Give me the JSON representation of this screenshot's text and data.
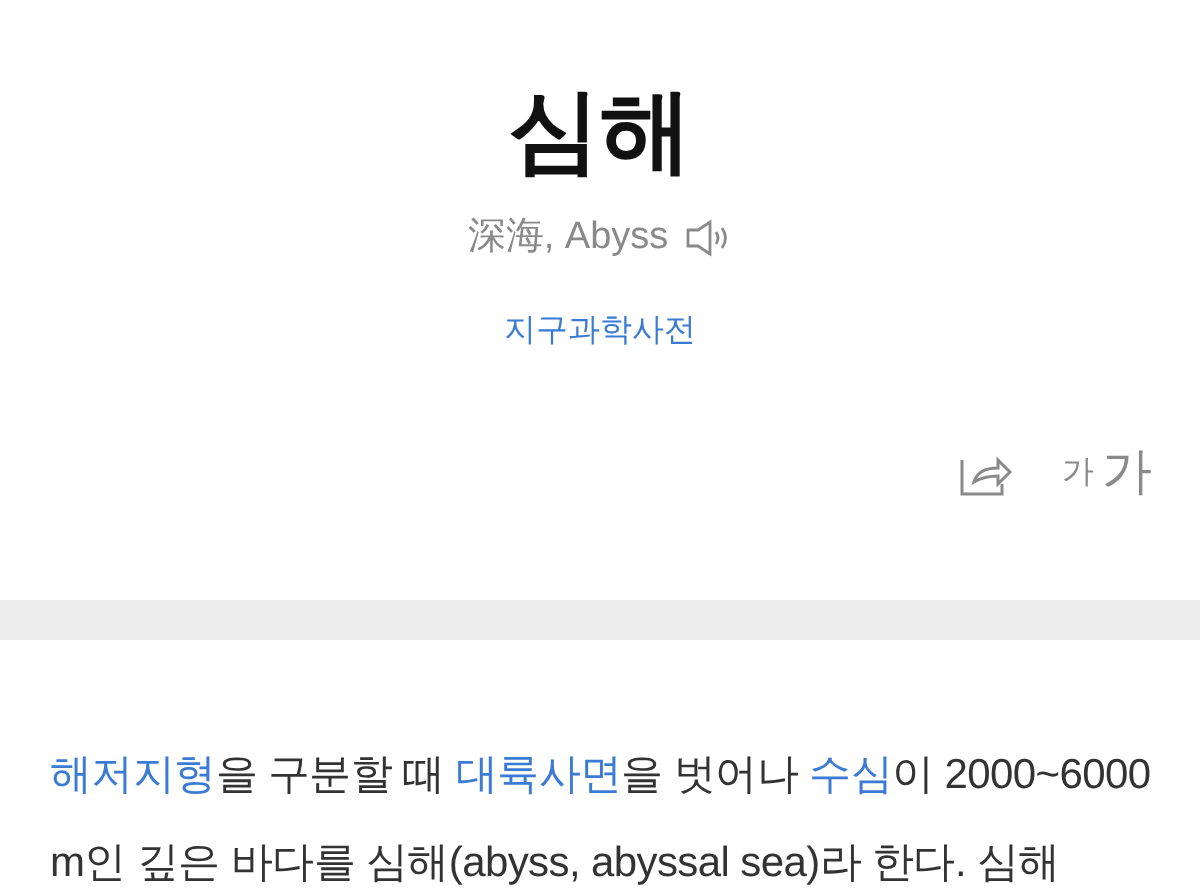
{
  "entry": {
    "title": "심해",
    "subtitle": "深海, Abyss",
    "source": "지구과학사전"
  },
  "toolbar": {
    "font_size_small": "가",
    "font_size_large": "가"
  },
  "paragraph": {
    "segments": [
      {
        "kind": "link",
        "text": "해저지형"
      },
      {
        "kind": "text",
        "text": "을 구분할 때 "
      },
      {
        "kind": "link",
        "text": "대륙사면"
      },
      {
        "kind": "text",
        "text": "을 벗어나 "
      },
      {
        "kind": "link",
        "text": "수심"
      },
      {
        "kind": "text",
        "text": "이 2000~6000 m인 깊은 바다를 심해(abyss, abyssal sea)라 한다. 심해"
      }
    ]
  }
}
